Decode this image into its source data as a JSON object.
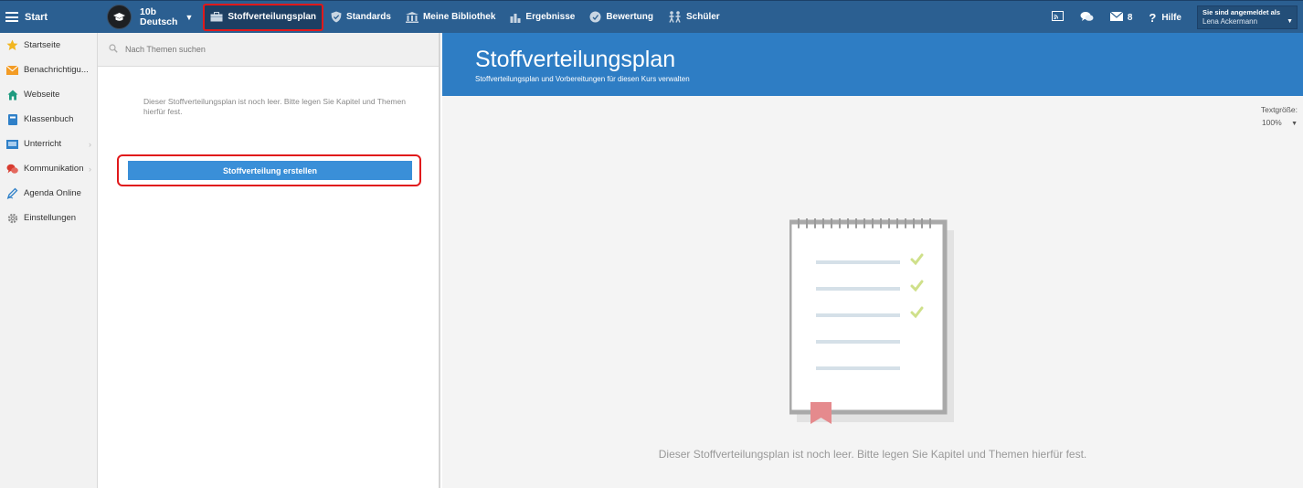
{
  "topbar": {
    "start_label": "Start",
    "course": {
      "line1": "10b",
      "line2": "Deutsch"
    },
    "nav": [
      {
        "label": "Stoffverteilungsplan",
        "icon": "briefcase-icon"
      },
      {
        "label": "Standards",
        "icon": "shield-icon"
      },
      {
        "label": "Meine Bibliothek",
        "icon": "library-icon"
      },
      {
        "label": "Ergebnisse",
        "icon": "bar-chart-icon"
      },
      {
        "label": "Bewertung",
        "icon": "rating-icon"
      },
      {
        "label": "Schüler",
        "icon": "students-icon"
      }
    ],
    "mail_count": "8",
    "help_label": "Hilfe",
    "user_caption": "Sie sind angemeldet als",
    "user_name": "Lena Ackermann"
  },
  "sidebar": {
    "items": [
      {
        "label": "Startseite",
        "icon": "star-icon"
      },
      {
        "label": "Benachrichtigu...",
        "icon": "envelope-icon"
      },
      {
        "label": "Webseite",
        "icon": "home-icon"
      },
      {
        "label": "Klassenbuch",
        "icon": "book-icon"
      },
      {
        "label": "Unterricht",
        "icon": "classroom-icon"
      },
      {
        "label": "Kommunikation",
        "icon": "chat-icon"
      },
      {
        "label": "Agenda Online",
        "icon": "pen-icon"
      },
      {
        "label": "Einstellungen",
        "icon": "gear-icon"
      }
    ]
  },
  "middle": {
    "search_placeholder": "Nach Themen suchen",
    "empty_message": "Dieser Stoffverteilungsplan ist noch leer. Bitte legen Sie Kapitel und Themen hierfür fest.",
    "create_button": "Stoffverteilung erstellen"
  },
  "right": {
    "title": "Stoffverteilungsplan",
    "subtitle": "Stoffverteilungsplan und Vorbereitungen für diesen Kurs verwalten",
    "textsize_label": "Textgröße:",
    "textsize_value": "100%",
    "empty_message": "Dieser Stoffverteilungsplan ist noch leer. Bitte legen Sie Kapitel und Themen hierfür fest."
  },
  "colors": {
    "topbar": "#2b5f91",
    "banner": "#2e7dc4",
    "button": "#3a8fd8",
    "highlight": "#e0191b"
  }
}
